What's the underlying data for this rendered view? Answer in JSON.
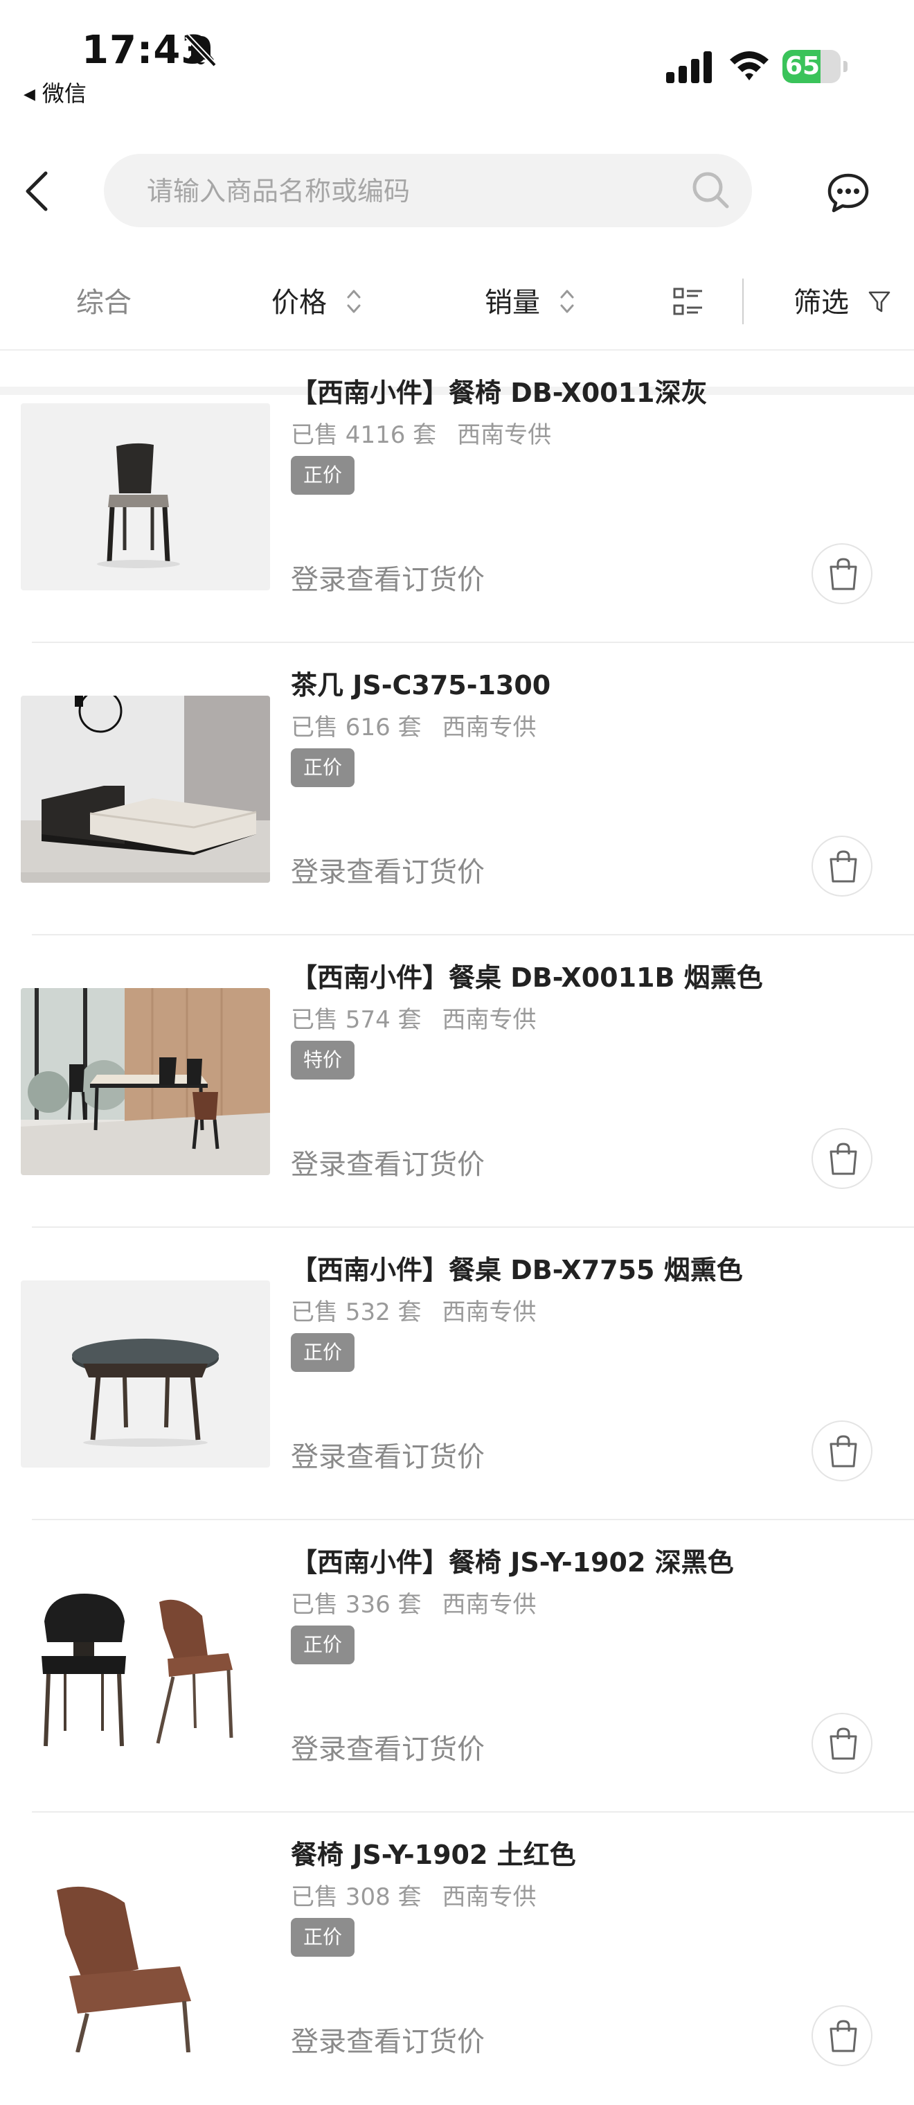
{
  "status_bar": {
    "time": "17:43",
    "back_app": "微信",
    "battery_level": "65",
    "battery_fraction": 0.65
  },
  "search": {
    "placeholder": "请输入商品名称或编码",
    "value": ""
  },
  "sort_bar": {
    "comprehensive": "综合",
    "price": "价格",
    "sales": "销量",
    "filter": "筛选"
  },
  "products": [
    {
      "title": "【西南小件】餐椅 DB-X0011深灰",
      "sold": "已售 4116 套",
      "supply": "西南专供",
      "badge": "正价",
      "price_text": "登录查看订货价",
      "thumb_icon": "dining-chair-gray"
    },
    {
      "title": "茶几 JS-C375-1300",
      "sold": "已售 616 套",
      "supply": "西南专供",
      "badge": "正价",
      "price_text": "登录查看订货价",
      "thumb_icon": "coffee-table"
    },
    {
      "title": "【西南小件】餐桌 DB-X0011B 烟熏色",
      "sold": "已售 574 套",
      "supply": "西南专供",
      "badge": "特价",
      "price_text": "登录查看订货价",
      "thumb_icon": "dining-table-room"
    },
    {
      "title": "【西南小件】餐桌 DB-X7755 烟熏色",
      "sold": "已售 532 套",
      "supply": "西南专供",
      "badge": "正价",
      "price_text": "登录查看订货价",
      "thumb_icon": "round-dining-table"
    },
    {
      "title": "【西南小件】餐椅 JS-Y-1902 深黑色",
      "sold": "已售 336 套",
      "supply": "西南专供",
      "badge": "正价",
      "price_text": "登录查看订货价",
      "thumb_icon": "dining-chairs-black-brown"
    },
    {
      "title": "餐椅 JS-Y-1902 土红色",
      "sold": "已售 308 套",
      "supply": "西南专供",
      "badge": "正价",
      "price_text": "登录查看订货价",
      "thumb_icon": "dining-chair-red"
    }
  ],
  "colors": {
    "badge_bg": "#8d8d8d",
    "battery_green": "#3ac35a",
    "muted_text": "#9a9a9a"
  }
}
